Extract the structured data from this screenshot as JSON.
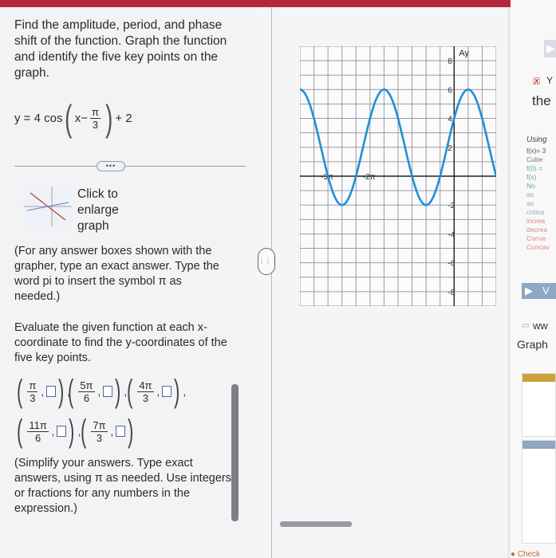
{
  "question": {
    "prompt": "Find the amplitude, period, and phase shift of the function. Graph the function and identify the five key points on the graph.",
    "equation": {
      "lhs": "y = 4 cos",
      "x": "x",
      "minus": "−",
      "pi_num": "π",
      "pi_den": "3",
      "plus": "+ 2"
    }
  },
  "toolbar": {
    "more_label": "•••"
  },
  "graph_thumb": {
    "enlarge_label": "Click to enlarge graph"
  },
  "note": "(For any answer boxes shown with the grapher, type an exact answer. Type the word pi to insert the symbol π as needed.)",
  "evaluate": "Evaluate the given function at each x-coordinate to find the y-coordinates of the five key points.",
  "key_points": [
    {
      "num": "π",
      "den": "3"
    },
    {
      "num": "5π",
      "den": "6"
    },
    {
      "num": "4π",
      "den": "3"
    },
    {
      "num": "11π",
      "den": "6"
    },
    {
      "num": "7π",
      "den": "3"
    }
  ],
  "simplify": "(Simplify your answers. Type exact answers, using π as needed. Use integers or fractions for any numbers in the expression.)",
  "graph": {
    "y_axis_label": "Ay",
    "y_tick_labels": [
      "8",
      "6",
      "4",
      "2",
      "-2",
      "-4",
      "-6",
      "-8"
    ],
    "x_tick_labels": [
      "-3π",
      "-2π"
    ],
    "curve_color": "#1e90d6",
    "function": {
      "amplitude": 4,
      "phase_shift": "π/3",
      "vertical_shift": 2
    }
  },
  "handle": {
    "label": "⋮⋮⋮"
  },
  "right_panel": {
    "flag_label": "Y",
    "the_label": "the",
    "using_label": "Using",
    "lines": [
      "f(x)= 3",
      "Cube",
      "f(0) =",
      "f(x)",
      "No",
      "as",
      "as",
      "critica",
      "increa",
      "decrea",
      "Conve",
      "Concav"
    ],
    "v_label": "V",
    "ww_label": "ww",
    "graph_label": "Graph",
    "check_label": "Check"
  }
}
